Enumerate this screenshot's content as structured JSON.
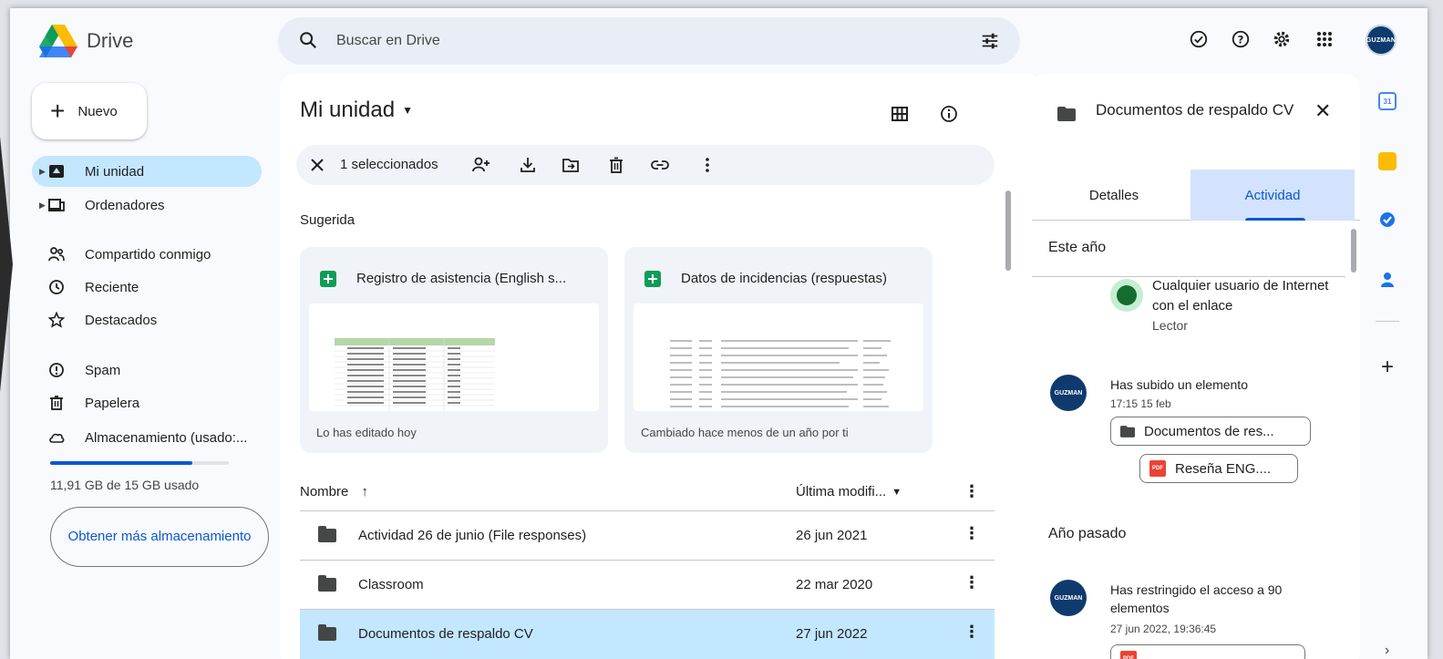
{
  "header": {
    "app_name": "Drive",
    "search_placeholder": "Buscar en Drive",
    "avatar_label": "GUZMAN"
  },
  "sidebar": {
    "new_label": "Nuevo",
    "items": [
      {
        "label": "Mi unidad",
        "icon": "drive-icon",
        "active": true
      },
      {
        "label": "Ordenadores",
        "icon": "computer-icon"
      },
      {
        "label": "Compartido conmigo",
        "icon": "shared-icon"
      },
      {
        "label": "Reciente",
        "icon": "clock-icon"
      },
      {
        "label": "Destacados",
        "icon": "star-icon"
      },
      {
        "label": "Spam",
        "icon": "spam-icon"
      },
      {
        "label": "Papelera",
        "icon": "trash-icon"
      },
      {
        "label": "Almacenamiento (usado:...",
        "icon": "cloud-icon"
      }
    ],
    "storage_text": "11,91 GB de 15 GB usado",
    "storage_fraction": 0.794,
    "more_storage_label": "Obtener más almacenamiento"
  },
  "main": {
    "title": "Mi unidad",
    "selection_count": "1 seleccionados",
    "suggested_label": "Sugerida",
    "cards": [
      {
        "title": "Registro de asistencia (English s...",
        "subtitle": "Lo has editado hoy"
      },
      {
        "title": "Datos de incidencias (respuestas)",
        "subtitle": "Cambiado hace menos de un año por ti"
      }
    ],
    "columns": {
      "name": "Nombre",
      "modified": "Última modifi..."
    },
    "files": [
      {
        "name": "Actividad 26 de junio (File responses)",
        "date": "26 jun 2021"
      },
      {
        "name": "Classroom",
        "date": "22 mar 2020"
      },
      {
        "name": "Documentos de respaldo CV",
        "date": "27 jun 2022",
        "selected": true
      }
    ]
  },
  "details": {
    "title": "Documentos de respaldo CV",
    "tabs": [
      "Detalles",
      "Actividad"
    ],
    "active_tab": "Actividad",
    "this_year": "Este año",
    "permission_text": "Cualquier usuario de Internet con el enlace",
    "permission_role": "Lector",
    "activity1_text": "Has subido un elemento",
    "activity1_time": "17:15 15 feb",
    "chip_folder": "Documentos de res...",
    "chip_pdf": "Reseña ENG....",
    "last_year": "Año pasado",
    "activity2_text": "Has restringido el acceso a 90 elementos",
    "activity2_time": "27 jun 2022, 19:36:45"
  },
  "colors": {
    "accent": "#0b57d0",
    "selected_bg": "#c2e7ff",
    "sheets_green": "#0f9d58"
  }
}
